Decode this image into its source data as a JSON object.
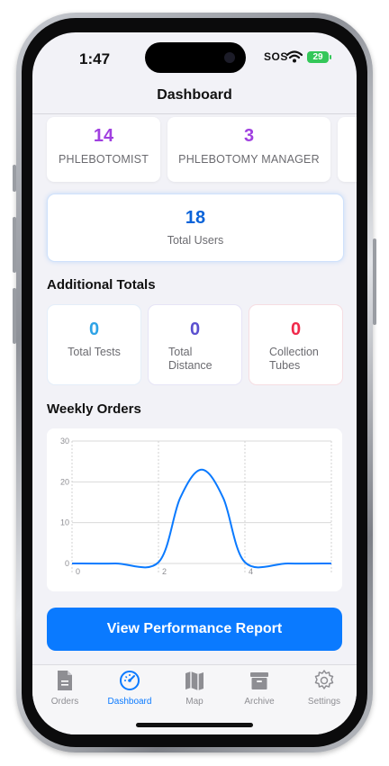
{
  "status_bar": {
    "time": "1:47",
    "sos": "SOS",
    "battery": "29"
  },
  "nav": {
    "title": "Dashboard"
  },
  "roles": [
    {
      "count": "14",
      "label": "PHLEBOTOMIST"
    },
    {
      "count": "3",
      "label": "PHLEBOTOMY MANAGER"
    }
  ],
  "total_users": {
    "count": "18",
    "label": "Total Users"
  },
  "additional": {
    "title": "Additional Totals",
    "items": [
      {
        "count": "0",
        "label": "Total Tests",
        "color": "#2ea3e6"
      },
      {
        "count": "0",
        "label": "Total\nDistance",
        "color": "#5a4fcf"
      },
      {
        "count": "0",
        "label": "Collection\nTubes",
        "color": "#f0284a"
      }
    ]
  },
  "weekly_orders": {
    "title": "Weekly Orders",
    "chart_data": {
      "type": "line",
      "x": [
        0,
        1,
        2,
        2.5,
        3,
        3.5,
        4,
        5,
        6
      ],
      "y": [
        0,
        0,
        0.3,
        16,
        23,
        16,
        0.3,
        0,
        0
      ],
      "xticks": [
        "0",
        "2",
        "4"
      ],
      "yticks": [
        "0",
        "10",
        "20",
        "30"
      ],
      "xlim": [
        0,
        6
      ],
      "ylim": [
        0,
        30
      ],
      "grid": true,
      "color": "#0a7aff"
    }
  },
  "action_button": {
    "label": "View Performance Report"
  },
  "tabs": [
    {
      "label": "Orders",
      "icon": "document-icon",
      "active": false
    },
    {
      "label": "Dashboard",
      "icon": "gauge-icon",
      "active": true
    },
    {
      "label": "Map",
      "icon": "map-icon",
      "active": false
    },
    {
      "label": "Archive",
      "icon": "archive-icon",
      "active": false
    },
    {
      "label": "Settings",
      "icon": "gear-icon",
      "active": false
    }
  ]
}
